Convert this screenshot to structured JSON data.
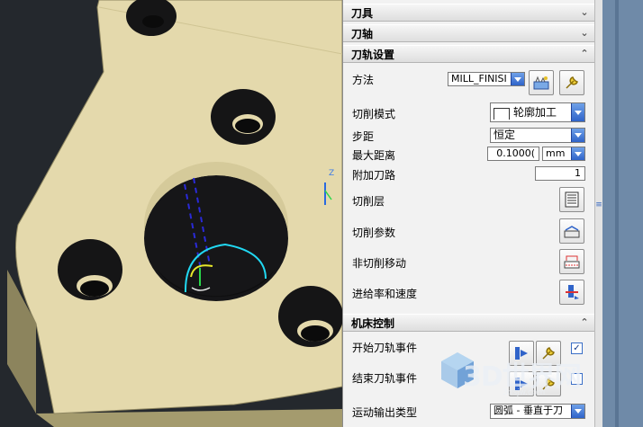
{
  "sections": {
    "tool": {
      "title": "刀具"
    },
    "axis": {
      "title": "刀轴"
    },
    "path_settings": {
      "title": "刀轨设置"
    },
    "machine_control": {
      "title": "机床控制"
    }
  },
  "path_settings": {
    "method_label": "方法",
    "method_value": "MILL_FINISI",
    "cut_pattern_label": "切削模式",
    "cut_pattern_value": "轮廓加工",
    "stepover_label": "步距",
    "stepover_value": "恒定",
    "max_distance_label": "最大距离",
    "max_distance_value": "0.1000(",
    "max_distance_unit": "mm",
    "additional_passes_label": "附加刀路",
    "additional_passes_value": "1",
    "cut_levels_label": "切削层",
    "cutting_params_label": "切削参数",
    "non_cutting_moves_label": "非切削移动",
    "feeds_speeds_label": "进给率和速度"
  },
  "machine_control": {
    "start_events_label": "开始刀轨事件",
    "end_events_label": "结束刀轨事件",
    "motion_output_label": "运动输出类型",
    "motion_output_value": "圆弧 - 垂直于刀"
  },
  "viewport": {
    "axis_label": "Z"
  },
  "watermark": {
    "main": "3D世界网",
    "sub": "3dsjw.com"
  },
  "colors": {
    "part_face": "#e4d9ac",
    "part_side": "#a49b6e",
    "background": "#24282d",
    "toolpath_cyan": "#21d8f2",
    "tool_axis_blue": "#2a2ad8",
    "accent_blue": "#2f63c9"
  }
}
